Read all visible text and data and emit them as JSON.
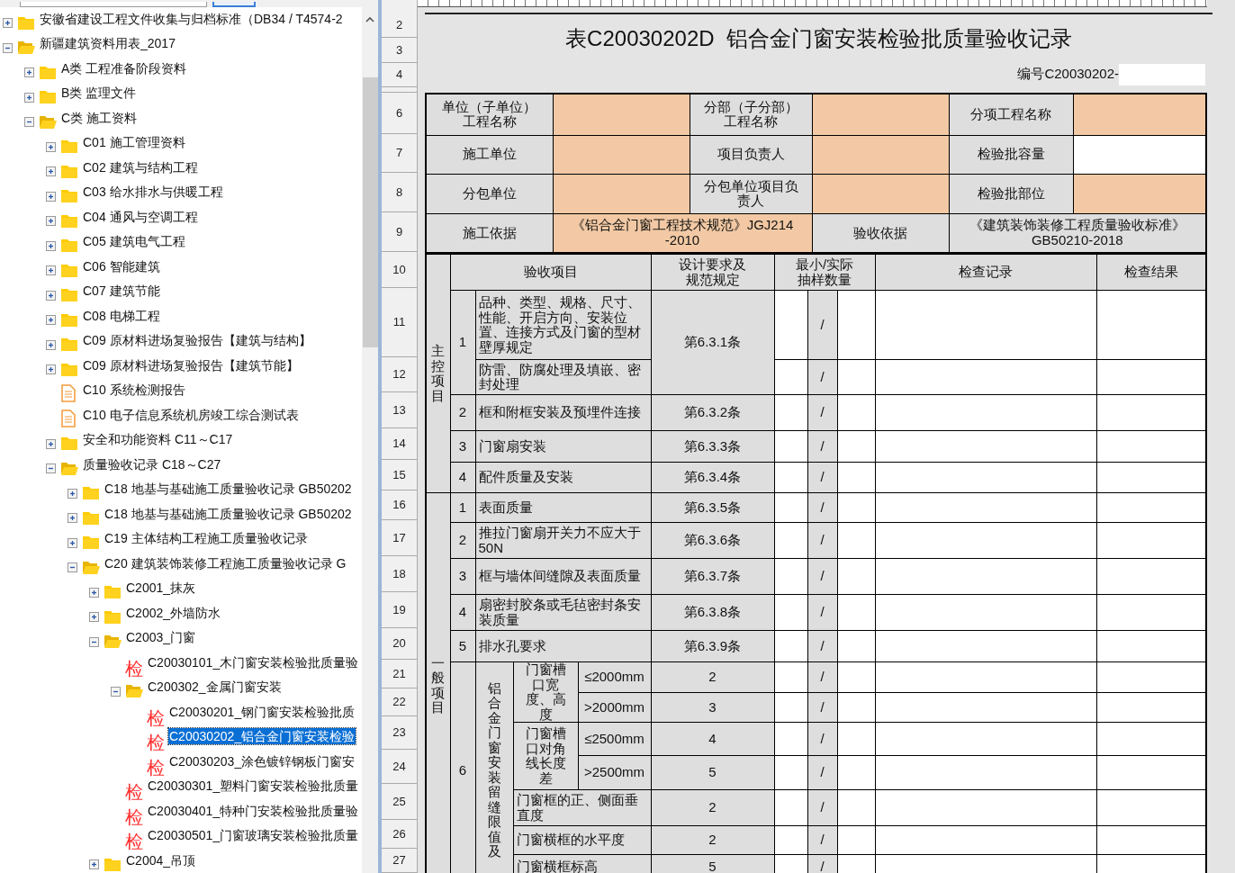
{
  "tree": [
    {
      "kind": "folder",
      "label": "安徽省建设工程文件收集与归档标准（DB34 / T4574-2",
      "expanded": false
    },
    {
      "kind": "folder",
      "label": "新疆建筑资料用表_2017",
      "expanded": true,
      "children": [
        {
          "kind": "folder",
          "label": "A类 工程准备阶段资料",
          "expanded": false
        },
        {
          "kind": "folder",
          "label": "B类 监理文件",
          "expanded": false
        },
        {
          "kind": "folder",
          "label": "C类 施工资料",
          "expanded": true,
          "children": [
            {
              "kind": "folder",
              "label": "C01 施工管理资料",
              "expanded": false
            },
            {
              "kind": "folder",
              "label": "C02 建筑与结构工程",
              "expanded": false
            },
            {
              "kind": "folder",
              "label": "C03 给水排水与供暖工程",
              "expanded": false
            },
            {
              "kind": "folder",
              "label": "C04 通风与空调工程",
              "expanded": false
            },
            {
              "kind": "folder",
              "label": "C05 建筑电气工程",
              "expanded": false
            },
            {
              "kind": "folder",
              "label": "C06 智能建筑",
              "expanded": false
            },
            {
              "kind": "folder",
              "label": "C07 建筑节能",
              "expanded": false
            },
            {
              "kind": "folder",
              "label": "C08 电梯工程",
              "expanded": false
            },
            {
              "kind": "folder",
              "label": "C09 原材料进场复验报告【建筑与结构】",
              "expanded": false
            },
            {
              "kind": "folder",
              "label": "C09 原材料进场复验报告【建筑节能】",
              "expanded": false
            },
            {
              "kind": "doc",
              "label": "C10 系统检测报告"
            },
            {
              "kind": "doc",
              "label": "C10 电子信息系统机房竣工综合测试表"
            },
            {
              "kind": "folder",
              "label": "安全和功能资料 C11～C17",
              "expanded": false
            },
            {
              "kind": "folder",
              "label": "质量验收记录 C18～C27",
              "expanded": true,
              "children": [
                {
                  "kind": "folder",
                  "label": "C18 地基与基础施工质量验收记录 GB50202",
                  "expanded": false
                },
                {
                  "kind": "folder",
                  "label": "C18 地基与基础施工质量验收记录 GB50202",
                  "expanded": false
                },
                {
                  "kind": "folder",
                  "label": "C19 主体结构工程施工质量验收记录",
                  "expanded": false
                },
                {
                  "kind": "folder",
                  "label": "C20 建筑装饰装修工程施工质量验收记录 G",
                  "expanded": true,
                  "children": [
                    {
                      "kind": "folder",
                      "label": "C2001_抹灰",
                      "expanded": false
                    },
                    {
                      "kind": "folder",
                      "label": "C2002_外墙防水",
                      "expanded": false
                    },
                    {
                      "kind": "folder",
                      "label": "C2003_门窗",
                      "expanded": true,
                      "children": [
                        {
                          "kind": "check",
                          "badge": "检",
                          "label": "C20030101_木门窗安装检验批质量验",
                          "selected": false
                        },
                        {
                          "kind": "folder",
                          "label": "C200302_金属门窗安装",
                          "expanded": true,
                          "children": [
                            {
                              "kind": "check",
                              "badge": "检",
                              "label": "C20030201_钢门窗安装检验批质",
                              "selected": false
                            },
                            {
                              "kind": "check",
                              "badge": "检",
                              "label": "C20030202_铝合金门窗安装检验",
                              "selected": true
                            },
                            {
                              "kind": "check",
                              "badge": "检",
                              "label": "C20030203_涂色镀锌钢板门窗安",
                              "selected": false
                            }
                          ]
                        },
                        {
                          "kind": "check",
                          "badge": "检",
                          "label": "C20030301_塑料门窗安装检验批质量",
                          "selected": false
                        },
                        {
                          "kind": "check",
                          "badge": "检",
                          "label": "C20030401_特种门安装检验批质量验",
                          "selected": false
                        },
                        {
                          "kind": "check",
                          "badge": "检",
                          "label": "C20030501_门窗玻璃安装检验批质量",
                          "selected": false
                        }
                      ]
                    },
                    {
                      "kind": "folder",
                      "label": "C2004_吊顶",
                      "expanded": false
                    }
                  ]
                }
              ]
            }
          ]
        }
      ]
    }
  ],
  "sheet": {
    "row_numbers": [
      "2",
      "3",
      "4",
      "6",
      "7",
      "8",
      "9",
      "10",
      "11",
      "12",
      "13",
      "14",
      "15",
      "16",
      "17",
      "18",
      "19",
      "20",
      "21",
      "22",
      "23",
      "24",
      "25",
      "26",
      "27"
    ],
    "title": "表C20030202D  铝合金门窗安装检验批质量验收记录",
    "number_label": "编号C20030202-",
    "info_rows": [
      [
        {
          "kind": "label",
          "text": "单位（子单位）工程名称"
        },
        {
          "kind": "input"
        },
        {
          "kind": "label",
          "text": "分部（子分部）工程名称"
        },
        {
          "kind": "input"
        },
        {
          "kind": "label",
          "text": "分项工程名称"
        },
        {
          "kind": "input"
        }
      ],
      [
        {
          "kind": "label",
          "text": "施工单位"
        },
        {
          "kind": "input"
        },
        {
          "kind": "label",
          "text": "项目负责人"
        },
        {
          "kind": "input"
        },
        {
          "kind": "label",
          "text": "检验批容量"
        },
        {
          "kind": "blank"
        }
      ],
      [
        {
          "kind": "label",
          "text": "分包单位"
        },
        {
          "kind": "input"
        },
        {
          "kind": "label",
          "text": "分包单位项目负责人"
        },
        {
          "kind": "input"
        },
        {
          "kind": "label",
          "text": "检验批部位"
        },
        {
          "kind": "input"
        }
      ],
      [
        {
          "kind": "label",
          "text": "施工依据"
        },
        {
          "kind": "input",
          "text": "《铝合金门窗工程技术规范》JGJ214\n-2010"
        },
        {
          "kind": "label",
          "text": "验收依据"
        },
        {
          "kind": "label",
          "text": "《建筑装饰装修工程质量验收标准》\nGB50210-2018"
        }
      ]
    ],
    "columns": [
      "验收项目",
      "设计要求及规范规定",
      "最小/实际抽样数量",
      "检查记录",
      "检查结果"
    ],
    "main_control": {
      "label": "主控项目",
      "items": [
        {
          "no": "1",
          "spec": "第6.3.1条",
          "checks": [
            {
              "text": "品种、类型、规格、尺寸、性能、开启方向、安装位置、连接方式及门窗的型材壁厚规定",
              "sample": "/"
            },
            {
              "text": "防雷、防腐处理及填嵌、密封处理",
              "sample": "/"
            }
          ]
        },
        {
          "no": "2",
          "spec": "第6.3.2条",
          "checks": [
            {
              "text": "框和附框安装及预埋件连接",
              "sample": "/"
            }
          ]
        },
        {
          "no": "3",
          "spec": "第6.3.3条",
          "checks": [
            {
              "text": "门窗扇安装",
              "sample": "/"
            }
          ]
        },
        {
          "no": "4",
          "spec": "第6.3.4条",
          "checks": [
            {
              "text": "配件质量及安装",
              "sample": "/"
            }
          ]
        }
      ]
    },
    "general": {
      "label": "一般项目",
      "items": [
        {
          "no": "1",
          "spec": "第6.3.5条",
          "checks": [
            {
              "text": "表面质量",
              "sample": "/"
            }
          ]
        },
        {
          "no": "2",
          "spec": "第6.3.6条",
          "checks": [
            {
              "text": "推拉门窗扇开关力不应大于50N",
              "sample": "/"
            }
          ]
        },
        {
          "no": "3",
          "spec": "第6.3.7条",
          "checks": [
            {
              "text": "框与墙体间缝隙及表面质量",
              "sample": "/"
            }
          ]
        },
        {
          "no": "4",
          "spec": "第6.3.8条",
          "checks": [
            {
              "text": "扇密封胶条或毛毡密封条安装质量",
              "sample": "/"
            }
          ]
        },
        {
          "no": "5",
          "spec": "第6.3.9条",
          "checks": [
            {
              "text": "排水孔要求",
              "sample": "/"
            }
          ]
        }
      ],
      "gap": {
        "no": "6",
        "label": "铝合金门窗安装留缝限值及",
        "groups": [
          {
            "label": "门窗槽口宽度、高度",
            "rows": [
              {
                "condition": "≤2000mm",
                "value": "2",
                "sample": "/"
              },
              {
                "condition": ">2000mm",
                "value": "3",
                "sample": "/"
              }
            ]
          },
          {
            "label": "门窗槽口对角线长度差",
            "rows": [
              {
                "condition": "≤2500mm",
                "value": "4",
                "sample": "/"
              },
              {
                "condition": ">2500mm",
                "value": "5",
                "sample": "/"
              }
            ]
          }
        ],
        "rows": [
          {
            "label": "门窗框的正、侧面垂直度",
            "value": "2",
            "sample": "/"
          },
          {
            "label": "门窗横框的水平度",
            "value": "2",
            "sample": "/"
          },
          {
            "label": "门窗横框标高",
            "value": "5",
            "sample": "/"
          }
        ]
      }
    }
  }
}
